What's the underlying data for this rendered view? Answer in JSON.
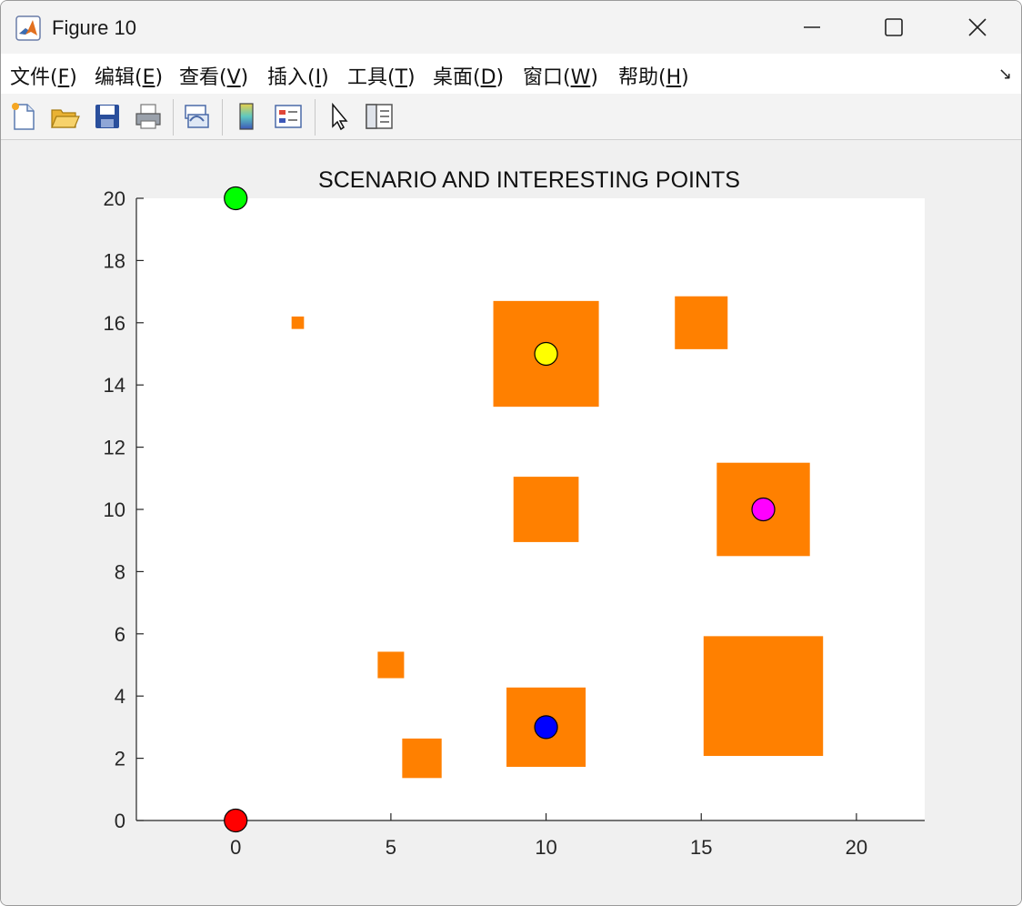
{
  "window": {
    "title": "Figure 10"
  },
  "menu": [
    {
      "label": "文件(",
      "key": "F",
      "tail": ")"
    },
    {
      "label": "编辑(",
      "key": "E",
      "tail": ")"
    },
    {
      "label": "查看(",
      "key": "V",
      "tail": ")"
    },
    {
      "label": "插入(",
      "key": "I",
      "tail": ")"
    },
    {
      "label": "工具(",
      "key": "T",
      "tail": ")"
    },
    {
      "label": "桌面(",
      "key": "D",
      "tail": ")"
    },
    {
      "label": "窗口(",
      "key": "W",
      "tail": ")"
    },
    {
      "label": "帮助(",
      "key": "H",
      "tail": ")"
    }
  ],
  "toolbar_icons": [
    "new-figure-icon",
    "open-file-icon",
    "save-icon",
    "print-icon",
    "link-plot-icon",
    "insert-colorbar-icon",
    "insert-legend-icon",
    "edit-plot-icon",
    "property-inspector-icon"
  ],
  "chart_data": {
    "type": "scatter",
    "title": "SCENARIO AND INTERESTING POINTS",
    "xlabel": "",
    "ylabel": "",
    "xlim": [
      -3.2,
      22.2
    ],
    "ylim": [
      0,
      20
    ],
    "xticks": [
      0,
      5,
      10,
      15,
      20
    ],
    "yticks": [
      0,
      2,
      4,
      6,
      8,
      10,
      12,
      14,
      16,
      18,
      20
    ],
    "grid": false,
    "obstacle_color": "#ff8000",
    "obstacles": [
      {
        "cx": 2,
        "cy": 16,
        "size": 0.4
      },
      {
        "cx": 10,
        "cy": 15,
        "size": 3.4
      },
      {
        "cx": 15,
        "cy": 16,
        "size": 1.7
      },
      {
        "cx": 10,
        "cy": 10,
        "size": 2.1
      },
      {
        "cx": 17,
        "cy": 10,
        "size": 3
      },
      {
        "cx": 5,
        "cy": 5,
        "size": 0.85
      },
      {
        "cx": 6,
        "cy": 2,
        "size": 1.27
      },
      {
        "cx": 10,
        "cy": 3,
        "size": 2.55
      },
      {
        "cx": 17,
        "cy": 4,
        "size": 3.85
      }
    ],
    "points": [
      {
        "x": 0,
        "y": 20,
        "color": "#00ff00"
      },
      {
        "x": 0,
        "y": 0,
        "color": "#ff0000"
      },
      {
        "x": 10,
        "y": 15,
        "color": "#ffff00"
      },
      {
        "x": 17,
        "y": 10,
        "color": "#ff00ff"
      },
      {
        "x": 10,
        "y": 3,
        "color": "#0000ff"
      }
    ]
  }
}
